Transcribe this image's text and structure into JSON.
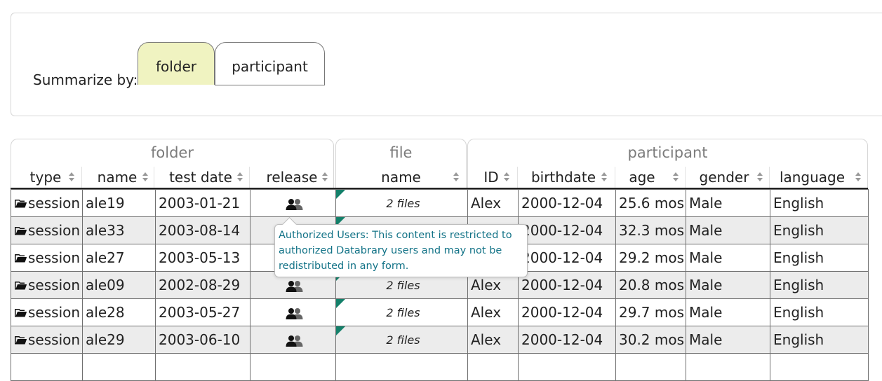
{
  "summary": {
    "label": "Summarize by:",
    "tabs": [
      {
        "label": "folder",
        "active": true
      },
      {
        "label": "participant",
        "active": false
      }
    ]
  },
  "groups": {
    "folder": "folder",
    "file": "file",
    "participant": "participant"
  },
  "columns": {
    "type": "type",
    "name": "name",
    "test_date": "test date",
    "release": "release",
    "file_name": "name",
    "id": "ID",
    "birthdate": "birthdate",
    "age": "age",
    "gender": "gender",
    "language": "language"
  },
  "rows": [
    {
      "type": "session",
      "name": "ale19",
      "test_date": "2003-01-21",
      "files": "2 files",
      "id": "Alex",
      "birthdate": "2000-12-04",
      "age": "25.6 mos",
      "gender": "Male",
      "language": "English"
    },
    {
      "type": "session",
      "name": "ale33",
      "test_date": "2003-08-14",
      "files": "",
      "id": "",
      "birthdate": "2000-12-04",
      "age": "32.3 mos",
      "gender": "Male",
      "language": "English"
    },
    {
      "type": "session",
      "name": "ale27",
      "test_date": "2003-05-13",
      "files": "",
      "id": "",
      "birthdate": "2000-12-04",
      "age": "29.2 mos",
      "gender": "Male",
      "language": "English"
    },
    {
      "type": "session",
      "name": "ale09",
      "test_date": "2002-08-29",
      "files": "2 files",
      "id": "Alex",
      "birthdate": "2000-12-04",
      "age": "20.8 mos",
      "gender": "Male",
      "language": "English"
    },
    {
      "type": "session",
      "name": "ale28",
      "test_date": "2003-05-27",
      "files": "2 files",
      "id": "Alex",
      "birthdate": "2000-12-04",
      "age": "29.7 mos",
      "gender": "Male",
      "language": "English"
    },
    {
      "type": "session",
      "name": "ale29",
      "test_date": "2003-06-10",
      "files": "2 files",
      "id": "Alex",
      "birthdate": "2000-12-04",
      "age": "30.2 mos",
      "gender": "Male",
      "language": "English"
    }
  ],
  "tooltip": {
    "text": "Authorized Users: This content is restricted to authorized Databrary users and may not be redistributed in any form."
  },
  "icons": {
    "type": "folder-icon",
    "release": "authorized-users-icon"
  },
  "colors": {
    "active_tab": "#f0f3c1",
    "tooltip_text": "#137387",
    "file_flag": "#14806a",
    "row_stripe": "#ececec"
  }
}
